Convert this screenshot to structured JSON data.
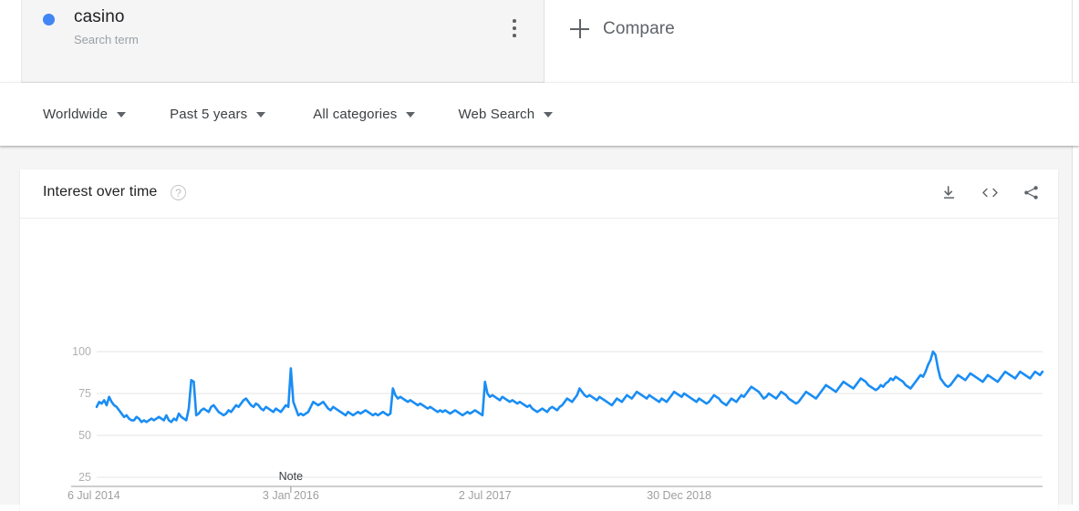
{
  "terms": {
    "selected": {
      "dot_color": "#4285f4",
      "title": "casino",
      "subtitle": "Search term",
      "menu_icon": "more-vert-icon"
    },
    "compare": {
      "label": "Compare",
      "icon": "plus-icon"
    }
  },
  "filters": [
    {
      "label": "Worldwide",
      "name": "location"
    },
    {
      "label": "Past 5 years",
      "name": "time-range"
    },
    {
      "label": "All categories",
      "name": "category"
    },
    {
      "label": "Web Search",
      "name": "search-type"
    }
  ],
  "interest_over_time": {
    "title": "Interest over time",
    "help_icon": "question-mark-icon",
    "help_glyph": "?",
    "actions": [
      {
        "name": "download-csv-button",
        "icon": "download-icon"
      },
      {
        "name": "embed-button",
        "icon": "code-brackets-icon"
      },
      {
        "name": "share-button",
        "icon": "share-icon"
      }
    ]
  },
  "chart_data": {
    "type": "line",
    "title": "Interest over time",
    "xlabel": "",
    "ylabel": "",
    "ylim": [
      0,
      100
    ],
    "yticks": [
      25,
      50,
      75,
      100
    ],
    "grid": true,
    "legend": false,
    "line_color": "#1a8df4",
    "annotations": [
      {
        "label": "Note",
        "x_label": "3 Jan 2016",
        "x_index": 78
      }
    ],
    "xticks": [
      {
        "label": "6 Jul 2014",
        "index": 0
      },
      {
        "label": "3 Jan 2016",
        "index": 78
      },
      {
        "label": "2 Jul 2017",
        "index": 156
      },
      {
        "label": "30 Dec 2018",
        "index": 234
      }
    ],
    "series": [
      {
        "name": "casino",
        "color": "#1a8df4",
        "values": [
          67,
          70,
          69,
          71,
          68,
          73,
          70,
          68,
          67,
          65,
          63,
          61,
          62,
          60,
          59,
          59,
          61,
          60,
          58,
          59,
          58,
          59,
          60,
          59,
          60,
          61,
          60,
          59,
          62,
          59,
          58,
          60,
          59,
          63,
          61,
          60,
          59,
          66,
          83,
          82,
          62,
          63,
          65,
          66,
          65,
          64,
          67,
          68,
          66,
          64,
          63,
          62,
          63,
          65,
          64,
          66,
          68,
          67,
          69,
          71,
          72,
          70,
          68,
          67,
          69,
          68,
          66,
          65,
          67,
          66,
          65,
          64,
          66,
          65,
          64,
          66,
          68,
          67,
          90,
          70,
          66,
          62,
          63,
          62,
          63,
          64,
          67,
          70,
          69,
          68,
          69,
          70,
          68,
          66,
          65,
          67,
          66,
          65,
          64,
          63,
          62,
          64,
          63,
          62,
          63,
          64,
          63,
          64,
          65,
          64,
          63,
          62,
          63,
          62,
          63,
          64,
          63,
          62,
          63,
          78,
          74,
          72,
          73,
          72,
          71,
          70,
          71,
          70,
          69,
          68,
          69,
          68,
          67,
          66,
          67,
          66,
          65,
          64,
          65,
          64,
          65,
          64,
          63,
          64,
          65,
          64,
          63,
          62,
          63,
          64,
          63,
          64,
          65,
          64,
          63,
          62,
          82,
          75,
          73,
          74,
          73,
          72,
          71,
          73,
          72,
          71,
          70,
          71,
          70,
          69,
          70,
          69,
          68,
          67,
          68,
          66,
          65,
          64,
          65,
          66,
          65,
          64,
          66,
          67,
          66,
          65,
          67,
          68,
          70,
          72,
          71,
          70,
          72,
          74,
          78,
          76,
          74,
          73,
          74,
          73,
          72,
          71,
          73,
          72,
          71,
          70,
          69,
          68,
          70,
          72,
          71,
          70,
          72,
          74,
          73,
          72,
          74,
          76,
          75,
          74,
          73,
          72,
          74,
          73,
          72,
          71,
          70,
          72,
          71,
          70,
          72,
          74,
          76,
          75,
          74,
          73,
          75,
          74,
          73,
          72,
          71,
          70,
          72,
          71,
          70,
          69,
          70,
          72,
          74,
          73,
          72,
          70,
          69,
          68,
          70,
          72,
          71,
          70,
          72,
          74,
          73,
          75,
          77,
          79,
          78,
          77,
          76,
          74,
          72,
          73,
          75,
          74,
          73,
          72,
          74,
          76,
          75,
          74,
          72,
          71,
          70,
          69,
          70,
          72,
          74,
          76,
          75,
          74,
          73,
          72,
          74,
          76,
          78,
          80,
          79,
          78,
          77,
          76,
          78,
          80,
          82,
          81,
          80,
          79,
          78,
          80,
          82,
          84,
          83,
          82,
          80,
          79,
          78,
          77,
          78,
          80,
          79,
          81,
          82,
          84,
          83,
          85,
          84,
          83,
          82,
          80,
          79,
          78,
          80,
          82,
          84,
          86,
          85,
          88,
          92,
          95,
          100,
          98,
          90,
          84,
          82,
          80,
          79,
          80,
          82,
          84,
          86,
          85,
          84,
          83,
          85,
          87,
          86,
          85,
          84,
          83,
          82,
          84,
          86,
          85,
          84,
          83,
          82,
          84,
          86,
          88,
          87,
          86,
          85,
          84,
          86,
          88,
          87,
          86,
          85,
          84,
          86,
          88,
          87,
          86,
          88
        ]
      }
    ]
  }
}
